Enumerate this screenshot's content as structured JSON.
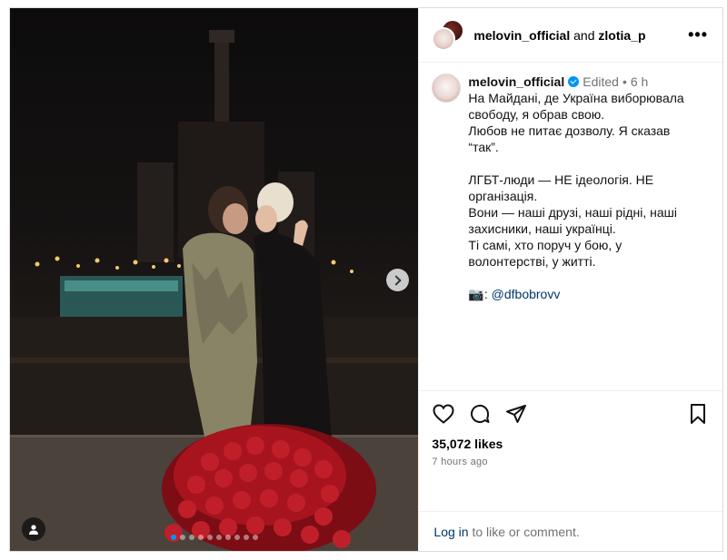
{
  "header": {
    "user1": "melovin_official",
    "joiner": "and",
    "user2": "zlotia_p",
    "more_label": "•••"
  },
  "caption": {
    "username": "melovin_official",
    "edited": "Edited",
    "separator": "•",
    "age": "6 h",
    "lines_1": [
      "На Майдані, де Україна виборювала",
      "свободу, я обрав свою.",
      "Любов не питає дозволу. Я сказав",
      "“так”."
    ],
    "lines_2": [
      "ЛГБТ-люди — НЕ ідеологія. НЕ",
      "організація.",
      "Вони — наші друзі, наші рідні, наші",
      "захисники, наші українці.",
      "Ті самі, хто поруч у бою, у",
      "волонтерстві, у житті."
    ],
    "credit_icon": "📷:",
    "credit_mention": "@dfbobrovv"
  },
  "actions": {
    "icons": [
      "heart-icon",
      "comment-icon",
      "share-icon",
      "save-icon"
    ],
    "likes": "35,072 likes",
    "time": "7 hours ago"
  },
  "comment": {
    "login": "Log in",
    "rest": " to like or comment."
  },
  "carousel": {
    "slide_count": 10,
    "active_index": 0
  },
  "colors": {
    "accent": "#0095f6",
    "link": "#00376b",
    "muted": "#737373",
    "border": "#dbdbdb"
  }
}
